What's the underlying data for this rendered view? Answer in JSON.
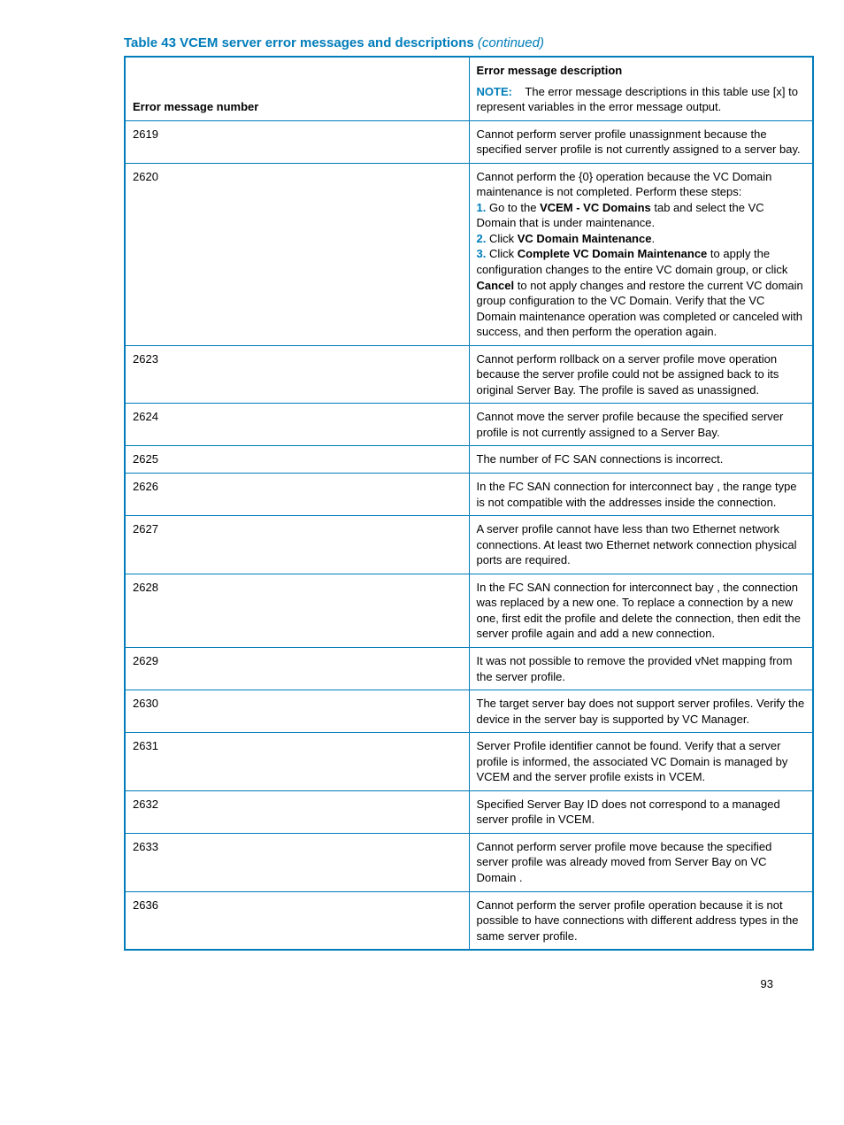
{
  "caption_main": "Table 43 VCEM server error messages and descriptions",
  "caption_cont": "(continued)",
  "header_col1": "Error message number",
  "header_col2_top": "Error message description",
  "header_note_label": "NOTE:",
  "header_note_text": "The error message descriptions in this table use [x] to represent variables in the error message output.",
  "rows": {
    "r2619": {
      "num": "2619",
      "desc": "Cannot perform server profile unassignment because the specified server profile is not currently assigned to a server bay."
    },
    "r2620": {
      "num": "2620",
      "intro": "Cannot perform the {0} operation because the VC Domain maintenance is not completed. Perform these steps:",
      "s1a": "Go to the ",
      "s1b": "VCEM - VC Domains",
      "s1c": " tab and select the VC Domain that is under maintenance.",
      "s2a": "Click ",
      "s2b": "VC Domain Maintenance",
      "s2c": ".",
      "s3a": "Click ",
      "s3b": "Complete VC Domain Maintenance",
      "s3c": " to apply the configuration changes to the entire VC domain group, or click ",
      "s3d": "Cancel",
      "s3e": " to not apply changes and restore the current VC domain group configuration to the VC Domain. Verify that the VC Domain maintenance operation was completed or canceled with success, and then perform the operation again."
    },
    "r2623": {
      "num": "2623",
      "desc": "Cannot perform rollback on a server profile move operation because the server profile could not be assigned back to its original Server Bay. The profile is saved as unassigned."
    },
    "r2624": {
      "num": "2624",
      "desc": "Cannot move the server profile because the specified server profile is not currently assigned to a Server Bay."
    },
    "r2625": {
      "num": "2625",
      "desc": "The number of FC SAN connections is incorrect."
    },
    "r2626": {
      "num": "2626",
      "desc": "In the FC SAN connection for interconnect bay , the range type is not compatible with the addresses inside the connection."
    },
    "r2627": {
      "num": "2627",
      "desc": "A server profile cannot have less than two Ethernet network connections. At least two Ethernet network connection physical ports are required."
    },
    "r2628": {
      "num": "2628",
      "desc": "In the FC SAN connection for interconnect bay , the connection was replaced by a new one. To replace a connection by a new one, first edit the profile and delete the connection, then edit the server profile again and add a new connection."
    },
    "r2629": {
      "num": "2629",
      "desc": "It was not possible to remove the provided vNet mapping from the server profile."
    },
    "r2630": {
      "num": "2630",
      "desc": "The target server bay does not support server profiles. Verify the device in the server bay is supported by VC Manager."
    },
    "r2631": {
      "num": "2631",
      "desc": "Server Profile identifier cannot be found. Verify that a server profile is informed, the associated VC Domain is managed by VCEM and the server profile exists in VCEM."
    },
    "r2632": {
      "num": "2632",
      "desc": "Specified Server Bay ID does not correspond to a managed server profile in VCEM."
    },
    "r2633": {
      "num": "2633",
      "desc": "Cannot perform server profile move because the specified server profile was already moved from Server Bay on VC Domain ."
    },
    "r2636": {
      "num": "2636",
      "desc": "Cannot perform the server profile operation because it is not possible to have connections with different address types in the same server profile."
    }
  },
  "pagenum": "93"
}
